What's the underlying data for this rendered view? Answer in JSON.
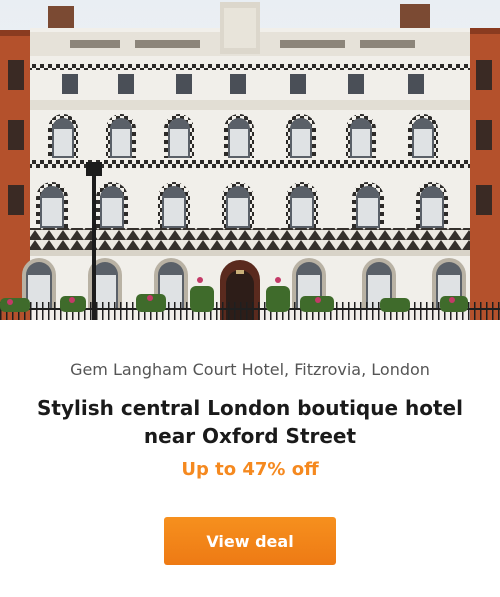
{
  "offer": {
    "location": "Gem Langham Court Hotel, Fitzrovia, London",
    "headline": "Stylish central London boutique hotel near Oxford Street",
    "discount": "Up to 47% off",
    "cta_label": "View deal"
  },
  "colors": {
    "accent": "#f5891f",
    "button": "#f18119",
    "facade": "#f1efea",
    "brick": "#b4512c"
  }
}
